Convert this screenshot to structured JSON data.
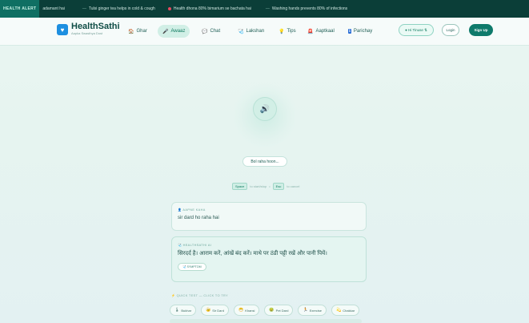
{
  "ticker": {
    "badge": "HEALTH ALERT",
    "items": [
      {
        "prefix": "",
        "text": "adamant hai"
      },
      {
        "prefix": "—",
        "text": "Tulsi ginger tea helps in cold & cough"
      },
      {
        "prefix": "dot",
        "text": "Health dhona 80% bimarium se bachata hai"
      },
      {
        "prefix": "—",
        "text": "Washing hands prevents 80% of infections"
      }
    ]
  },
  "nav": {
    "brand_name": "HealthSathi",
    "brand_tagline": "Aapka Swasthya Dost",
    "items": [
      {
        "label": "Ghar",
        "icon": "home-icon",
        "glyph": "🏠",
        "active": false
      },
      {
        "label": "Awaaz",
        "icon": "mic-icon",
        "glyph": "🎤",
        "active": true
      },
      {
        "label": "Chat",
        "icon": "chat-icon",
        "glyph": "💬",
        "active": false
      },
      {
        "label": "Lakshan",
        "icon": "stethoscope-icon",
        "glyph": "🩺",
        "active": false
      },
      {
        "label": "Tips",
        "icon": "bulb-icon",
        "glyph": "💡",
        "active": false
      },
      {
        "label": "Aaptkaal",
        "icon": "siren-icon",
        "glyph": "🚨",
        "active": false
      },
      {
        "label": "Parichay",
        "icon": "info-icon",
        "glyph": "ℹ",
        "active": false
      }
    ],
    "lang_pill": "● Hi Tinuse ⇅",
    "login": "Login",
    "signup": "Sign Up"
  },
  "hero": {
    "status": "Bol raha hoon...",
    "hint_key1": "Space",
    "hint_text1": "to start/stop",
    "hint_sep": "•",
    "hint_key2": "Esc",
    "hint_text2": "to cancel"
  },
  "conversation": {
    "you_label": "AAPNE KAHA",
    "you_icon": "user-icon",
    "you_text": "sir dard ho raha hai",
    "ai_label": "HEALTHSATHI AI",
    "ai_icon": "ai-icon",
    "ai_text": "सिरदर्द है। आराम करें, आंखें बंद करें। माथे पर ठंडी पट्टी रखें और पानी पियें।",
    "ai_tag": "SYMPTOM"
  },
  "quick_test": {
    "label": "QUICK TEST — CLICK TO TRY",
    "chips": [
      {
        "label": "Bukhar",
        "icon": "thermometer-icon",
        "glyph": "🌡"
      },
      {
        "label": "Sir Dard",
        "icon": "head-icon",
        "glyph": "🤕"
      },
      {
        "label": "Khansi",
        "icon": "cough-icon",
        "glyph": "😷"
      },
      {
        "label": "Pet Dard",
        "icon": "stomach-icon",
        "glyph": "🤢"
      },
      {
        "label": "Exercise",
        "icon": "exercise-icon",
        "glyph": "🏃"
      },
      {
        "label": "Chakkar",
        "icon": "dizzy-icon",
        "glyph": "💫"
      }
    ]
  },
  "colors": {
    "accent": "#0e7a6b",
    "brand_blue": "#1d8fe0",
    "ticker_bg": "#0b3e38"
  }
}
